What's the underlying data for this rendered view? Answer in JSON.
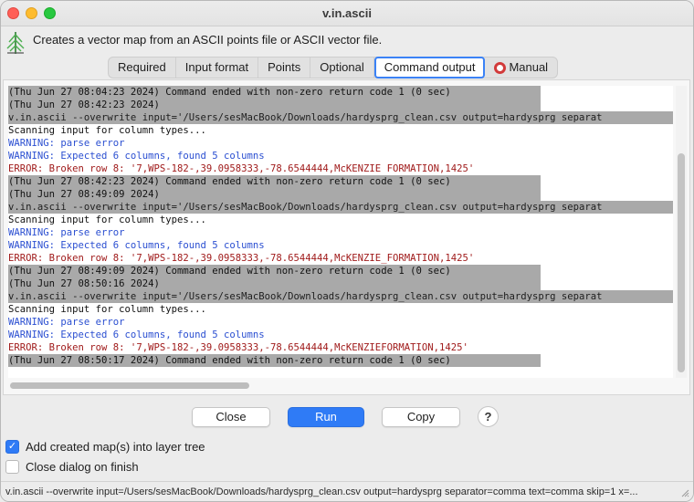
{
  "window": {
    "title": "v.in.ascii"
  },
  "header": {
    "description": "Creates a vector map from an ASCII points file or ASCII vector file."
  },
  "tabs": [
    {
      "label": "Required"
    },
    {
      "label": "Input format"
    },
    {
      "label": "Points"
    },
    {
      "label": "Optional"
    },
    {
      "label": "Command output"
    },
    {
      "label": "Manual"
    }
  ],
  "active_tab": "Command output",
  "output": {
    "lines": [
      {
        "kind": "cmd",
        "text": "(Thu Jun 27 08:04:23 2024) Command ended with non-zero return code 1 (0 sec)"
      },
      {
        "kind": "cmd",
        "text": "(Thu Jun 27 08:42:23 2024)"
      },
      {
        "kind": "cmdfull",
        "text": "v.in.ascii --overwrite input='/Users/sesMacBook/Downloads/hardysprg_clean.csv output=hardysprg separat"
      },
      {
        "kind": "plain",
        "text": "Scanning input for column types..."
      },
      {
        "kind": "warn",
        "text": "WARNING: parse error"
      },
      {
        "kind": "warn",
        "text": "WARNING: Expected 6 columns, found 5 columns"
      },
      {
        "kind": "err",
        "text": "ERROR: Broken row 8: '7,WPS-182-,39.0958333,-78.6544444,McKENZIE FORMATION,1425'"
      },
      {
        "kind": "cmd",
        "text": "(Thu Jun 27 08:42:23 2024) Command ended with non-zero return code 1 (0 sec)"
      },
      {
        "kind": "cmd",
        "text": "(Thu Jun 27 08:49:09 2024)"
      },
      {
        "kind": "cmdfull",
        "text": "v.in.ascii --overwrite input='/Users/sesMacBook/Downloads/hardysprg_clean.csv output=hardysprg separat"
      },
      {
        "kind": "plain",
        "text": "Scanning input for column types..."
      },
      {
        "kind": "warn",
        "text": "WARNING: parse error"
      },
      {
        "kind": "warn",
        "text": "WARNING: Expected 6 columns, found 5 columns"
      },
      {
        "kind": "err",
        "text": "ERROR: Broken row 8: '7,WPS-182-,39.0958333,-78.6544444,McKENZIE_FORMATION,1425'"
      },
      {
        "kind": "cmd",
        "text": "(Thu Jun 27 08:49:09 2024) Command ended with non-zero return code 1 (0 sec)"
      },
      {
        "kind": "cmd",
        "text": "(Thu Jun 27 08:50:16 2024)"
      },
      {
        "kind": "cmdfull",
        "text": "v.in.ascii --overwrite input='/Users/sesMacBook/Downloads/hardysprg_clean.csv output=hardysprg separat"
      },
      {
        "kind": "plain",
        "text": "Scanning input for column types..."
      },
      {
        "kind": "warn",
        "text": "WARNING: parse error"
      },
      {
        "kind": "warn",
        "text": "WARNING: Expected 6 columns, found 5 columns"
      },
      {
        "kind": "err",
        "text": "ERROR: Broken row 8: '7,WPS-182-,39.0958333,-78.6544444,McKENZIEFORMATION,1425'"
      },
      {
        "kind": "cmd",
        "text": "(Thu Jun 27 08:50:17 2024) Command ended with non-zero return code 1 (0 sec)"
      }
    ]
  },
  "buttons": {
    "close": "Close",
    "run": "Run",
    "copy": "Copy",
    "help": "?"
  },
  "options": {
    "add_to_tree": {
      "label": "Add created map(s) into layer tree",
      "checked": true
    },
    "close_on_finish": {
      "label": "Close dialog on finish",
      "checked": false
    }
  },
  "statusbar": {
    "text": "v.in.ascii --overwrite input=/Users/sesMacBook/Downloads/hardysprg_clean.csv output=hardysprg separator=comma text=comma skip=1 x=..."
  },
  "colors": {
    "accent": "#2f7bf6",
    "warning_text": "#2b4fd1",
    "error_text": "#a01b1b",
    "command_highlight": "#a9a9a9"
  }
}
